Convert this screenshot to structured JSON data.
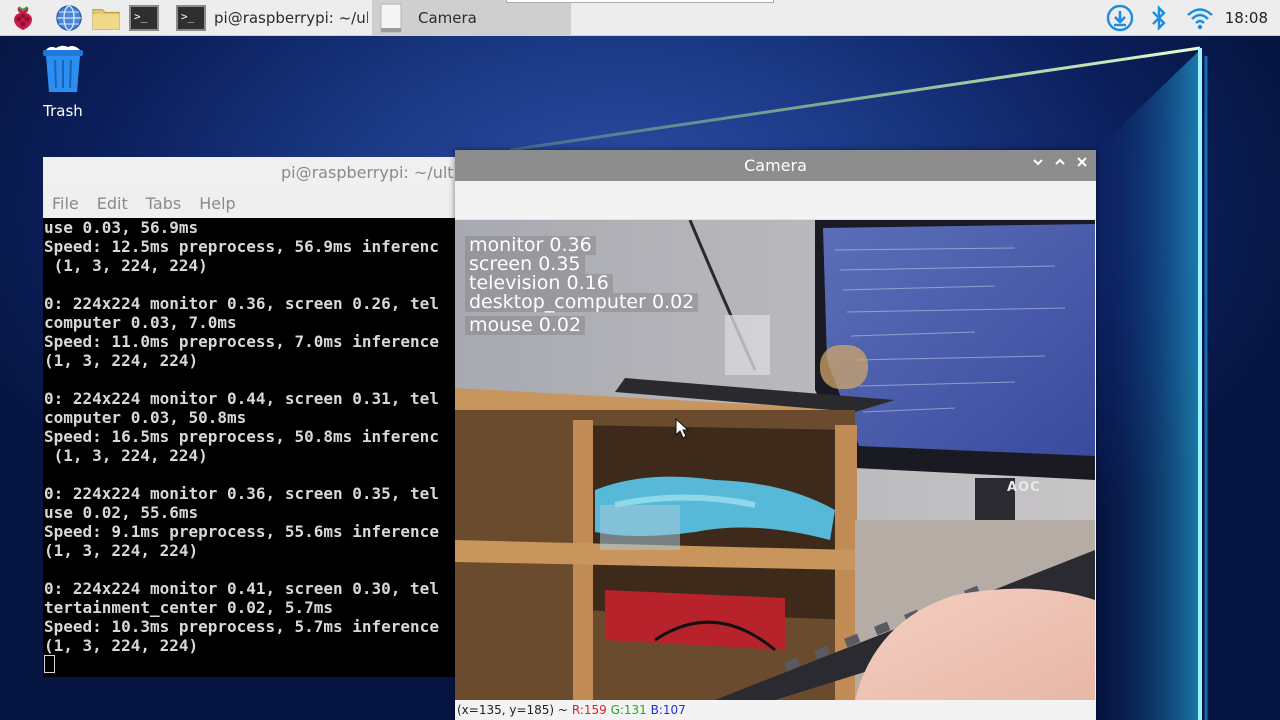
{
  "taskbar": {
    "tasks": [
      {
        "label": "pi@raspberrypi: ~/ul..",
        "active": false
      },
      {
        "label": "Camera",
        "active": true
      }
    ],
    "clock": "18:08"
  },
  "desktop": {
    "trash_label": "Trash"
  },
  "terminal": {
    "title": "pi@raspberrypi: ~/ultraly",
    "menu": [
      "File",
      "Edit",
      "Tabs",
      "Help"
    ],
    "lines": [
      "use 0.03, 56.9ms",
      "Speed: 12.5ms preprocess, 56.9ms inferenc",
      " (1, 3, 224, 224)",
      "",
      "0: 224x224 monitor 0.36, screen 0.26, tel",
      "computer 0.03, 7.0ms",
      "Speed: 11.0ms preprocess, 7.0ms inference",
      "(1, 3, 224, 224)",
      "",
      "0: 224x224 monitor 0.44, screen 0.31, tel",
      "computer 0.03, 50.8ms",
      "Speed: 16.5ms preprocess, 50.8ms inferenc",
      " (1, 3, 224, 224)",
      "",
      "0: 224x224 monitor 0.36, screen 0.35, tel",
      "use 0.02, 55.6ms",
      "Speed: 9.1ms preprocess, 55.6ms inference",
      "(1, 3, 224, 224)",
      "",
      "0: 224x224 monitor 0.41, screen 0.30, tel",
      "tertainment_center 0.02, 5.7ms",
      "Speed: 10.3ms preprocess, 5.7ms inference",
      "(1, 3, 224, 224)"
    ]
  },
  "camera": {
    "title": "Camera",
    "detections": [
      "monitor 0.36",
      "screen 0.35",
      "television 0.16",
      "desktop_computer 0.02",
      "mouse 0.02"
    ],
    "status": {
      "coords": "(x=135, y=185) ~",
      "r": "R:159",
      "g": "G:131",
      "b": "B:107"
    },
    "monitor_brand": "AOC"
  },
  "colors": {
    "status_r": "#e02020",
    "status_g": "#1fa81f",
    "status_b": "#2030d0",
    "taskbar_bg": "#ededed",
    "camera_titlebar": "#8d8d8d"
  }
}
